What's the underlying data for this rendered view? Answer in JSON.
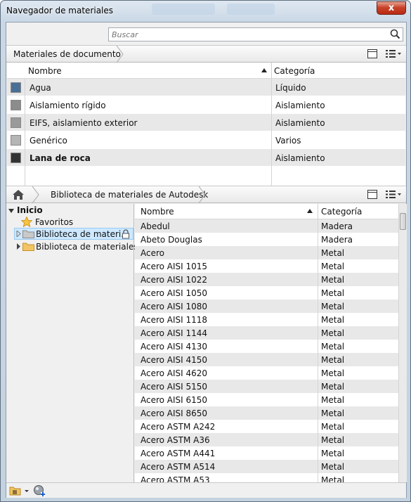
{
  "window": {
    "title": "Navegador de materiales",
    "close_label": "x"
  },
  "search": {
    "placeholder": "Buscar"
  },
  "document_materials": {
    "breadcrumb": "Materiales de documento",
    "col_name": "Nombre",
    "col_category": "Categoría",
    "rows": [
      {
        "name": "Agua",
        "category": "Líquido",
        "swatch": "#4a6f96"
      },
      {
        "name": "Aislamiento rígido",
        "category": "Aislamiento",
        "swatch": "#8c8c8c"
      },
      {
        "name": "EIFS, aislamiento exterior",
        "category": "Aislamiento",
        "swatch": "#9a9a9a"
      },
      {
        "name": "Genérico",
        "category": "Varios",
        "swatch": "#b5b5b5"
      },
      {
        "name": "Lana de roca",
        "category": "Aislamiento",
        "swatch": "#333333"
      }
    ]
  },
  "library_bar": {
    "breadcrumb": "Biblioteca de materiales de Autodesk"
  },
  "tree": {
    "root": "Inicio",
    "favorites": "Favoritos",
    "items": [
      "Biblioteca de materi...",
      "Biblioteca de materiales ..."
    ]
  },
  "library": {
    "col_name": "Nombre",
    "col_category": "Categoría",
    "rows": [
      {
        "name": "Abedul",
        "category": "Madera"
      },
      {
        "name": "Abeto Douglas",
        "category": "Madera"
      },
      {
        "name": "Acero",
        "category": "Metal"
      },
      {
        "name": "Acero AISI 1015",
        "category": "Metal"
      },
      {
        "name": "Acero AISI 1022",
        "category": "Metal"
      },
      {
        "name": "Acero AISI 1050",
        "category": "Metal"
      },
      {
        "name": "Acero AISI 1080",
        "category": "Metal"
      },
      {
        "name": "Acero AISI 1118",
        "category": "Metal"
      },
      {
        "name": "Acero AISI 1144",
        "category": "Metal"
      },
      {
        "name": "Acero AISI 4130",
        "category": "Metal"
      },
      {
        "name": "Acero AISI 4150",
        "category": "Metal"
      },
      {
        "name": "Acero AISI 4620",
        "category": "Metal"
      },
      {
        "name": "Acero AISI 5150",
        "category": "Metal"
      },
      {
        "name": "Acero AISI 6150",
        "category": "Metal"
      },
      {
        "name": "Acero AISI 8650",
        "category": "Metal"
      },
      {
        "name": "Acero ASTM A242",
        "category": "Metal"
      },
      {
        "name": "Acero ASTM A36",
        "category": "Metal"
      },
      {
        "name": "Acero ASTM A441",
        "category": "Metal"
      },
      {
        "name": "Acero ASTM A514",
        "category": "Metal"
      },
      {
        "name": "Acero ASTM A53",
        "category": "Metal"
      }
    ]
  },
  "colors": {
    "row_alt": "#e8e8e8",
    "selection": "#cde8ff",
    "accent": "#3b7dd8"
  }
}
